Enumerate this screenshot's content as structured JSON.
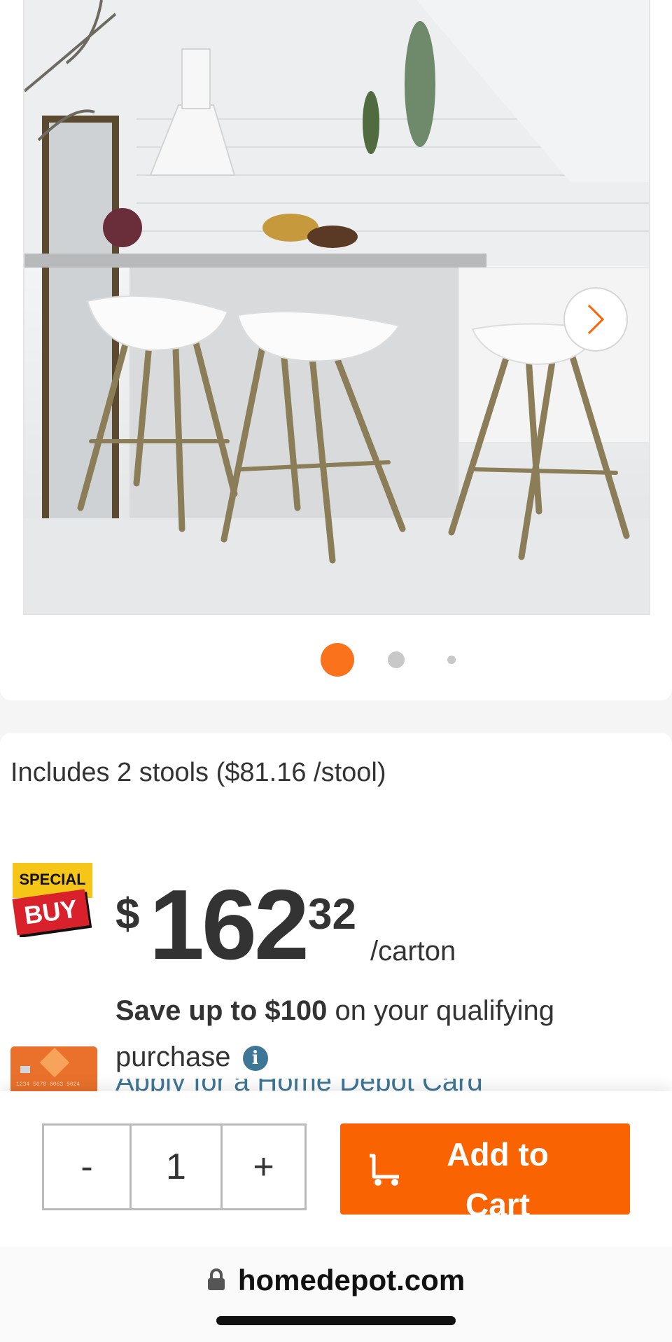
{
  "gallery": {
    "image_alt": "White bar stools with brass legs in a kitchen",
    "next_icon": "chevron-right-icon",
    "active_dot": 1,
    "dot_count": 3
  },
  "product": {
    "includes_text": "Includes 2 stools ($81.16 /stool)",
    "badge_top": "SPECIAL",
    "badge_bottom": "BUY",
    "price_symbol": "$",
    "price_whole": "162",
    "price_cents": "32",
    "price_unit": "/carton",
    "save_bold": "Save up to $100",
    "save_rest": " on your qualifying purchase",
    "info_icon": "i",
    "apply_link": "Apply for a Home Depot Card"
  },
  "cart": {
    "minus_label": "-",
    "quantity": "1",
    "plus_label": "+",
    "add_label": "Add to Cart"
  },
  "browser": {
    "url": "homedepot.com"
  },
  "colors": {
    "brand_orange": "#f96302",
    "link_blue": "#3e7697",
    "text": "#333333"
  }
}
